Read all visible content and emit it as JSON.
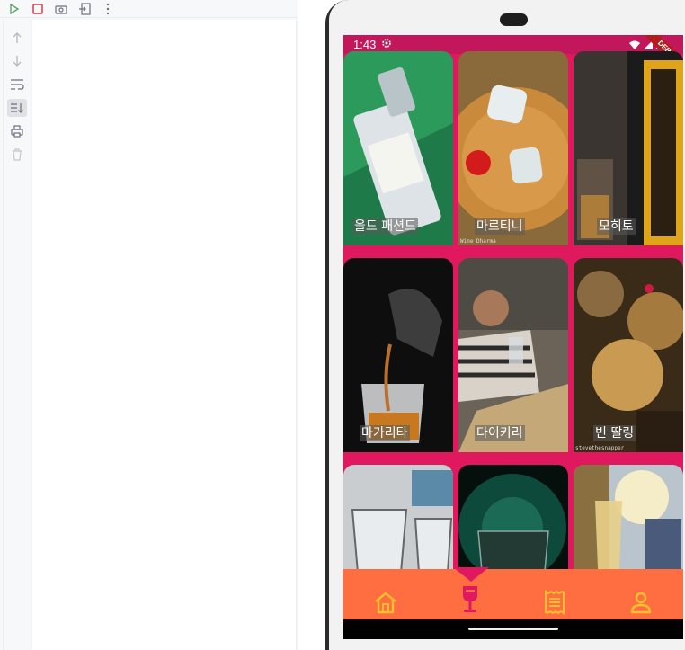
{
  "status_bar": {
    "time": "1:43",
    "debug_label": "DEBUG"
  },
  "cocktails": [
    {
      "name": "올드 패션드",
      "credit": ""
    },
    {
      "name": "마르티니",
      "credit": "Wine Dharma"
    },
    {
      "name": "모히토",
      "credit": ""
    },
    {
      "name": "마가리타",
      "credit": ""
    },
    {
      "name": "다이키리",
      "credit": ""
    },
    {
      "name": "빈 딸링",
      "credit": "stevethesnapper"
    },
    {
      "name": "",
      "credit": ""
    },
    {
      "name": "",
      "credit": ""
    },
    {
      "name": "",
      "credit": ""
    }
  ],
  "bottom_nav": [
    "home-icon",
    "wine-glass-icon",
    "receipt-icon",
    "person-icon"
  ],
  "colors": {
    "accent": "#e0195f",
    "nav": "#ff6e40",
    "nav_icon": "#fbc02d"
  }
}
